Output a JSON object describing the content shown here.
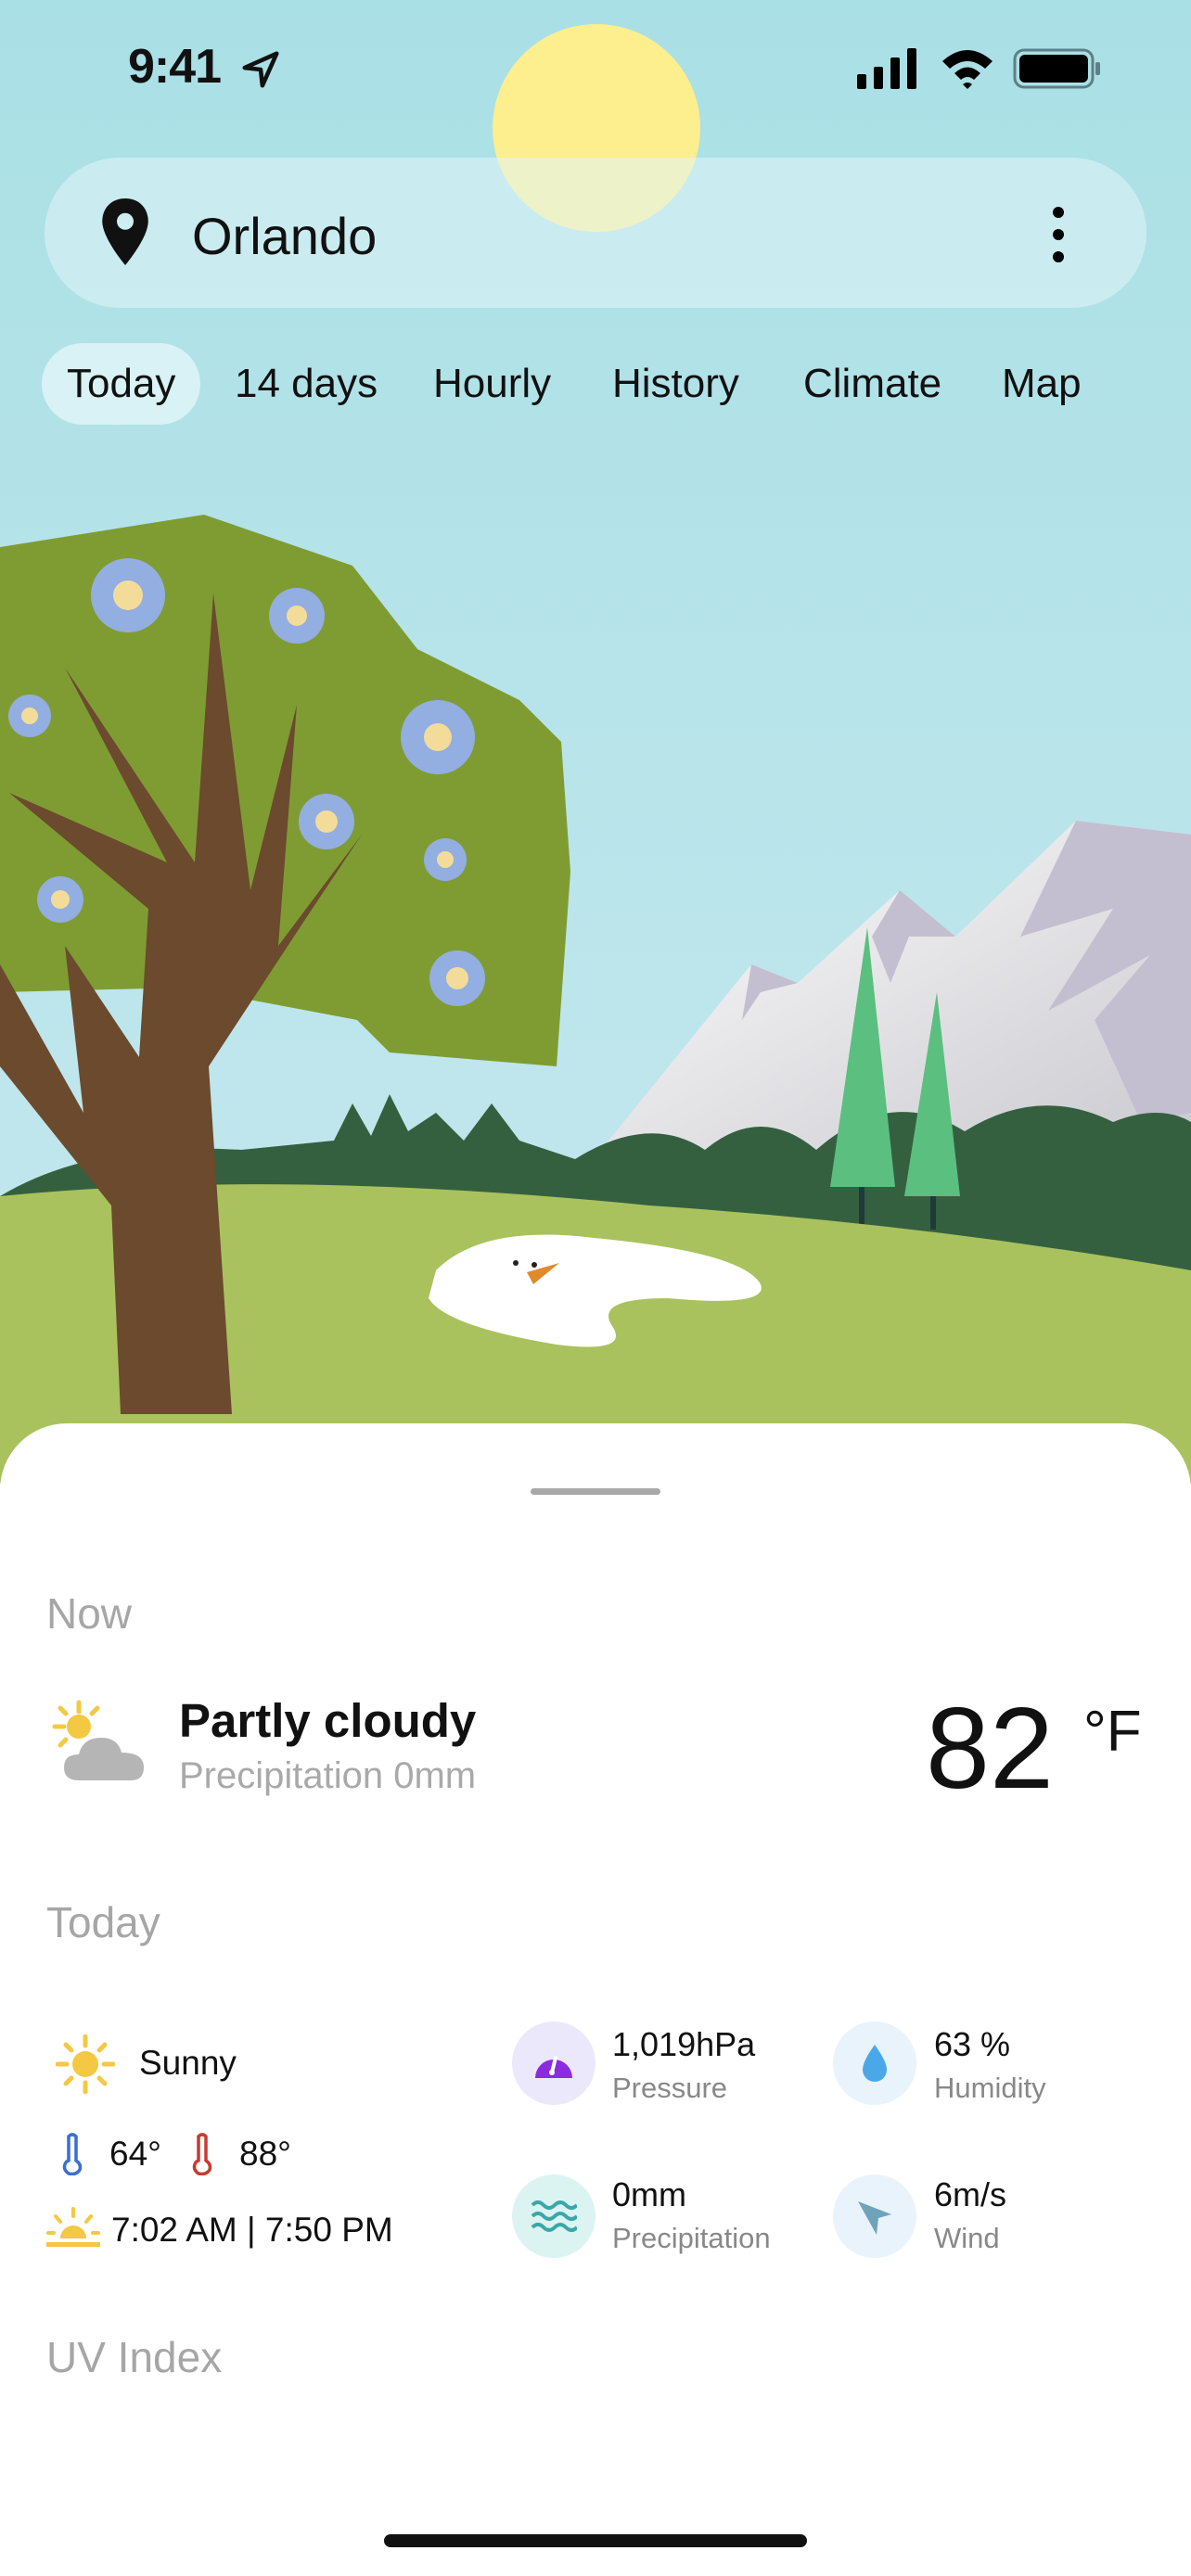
{
  "status_bar": {
    "time": "9:41"
  },
  "search": {
    "city": "Orlando",
    "icons": [
      "location-pin-icon",
      "more-vertical-icon"
    ]
  },
  "tabs": [
    {
      "label": "Today",
      "active": true
    },
    {
      "label": "14 days",
      "active": false
    },
    {
      "label": "Hourly",
      "active": false
    },
    {
      "label": "History",
      "active": false
    },
    {
      "label": "Climate",
      "active": false
    },
    {
      "label": "Map",
      "active": false
    }
  ],
  "now": {
    "heading": "Now",
    "condition": "Partly cloudy",
    "precipitation": "Precipitation 0mm",
    "temperature": "82",
    "unit": "°F",
    "icon": "partly-cloudy-icon"
  },
  "today": {
    "heading": "Today",
    "condition": "Sunny",
    "low": "64°",
    "high": "88°",
    "sun_times": "7:02 AM | 7:50 PM",
    "stats": [
      {
        "value": "1,019hPa",
        "label": "Pressure",
        "icon": "gauge-icon",
        "color": "#8a2be2"
      },
      {
        "value": "63 %",
        "label": "Humidity",
        "icon": "droplet-icon",
        "color": "#4aa8e8"
      },
      {
        "value": "0mm",
        "label": "Precipitation",
        "icon": "waves-icon",
        "color": "#3aa8a8"
      },
      {
        "value": "6m/s",
        "label": "Wind",
        "icon": "wind-direction-icon",
        "color": "#6fa3bc"
      }
    ]
  },
  "uv": {
    "heading": "UV Index"
  },
  "colors": {
    "sky": "#a8e0e6",
    "sun": "#fdee8e",
    "foliage": "#7f9c33",
    "trunk": "#6b4a2e",
    "grass": "#a9c25e"
  }
}
